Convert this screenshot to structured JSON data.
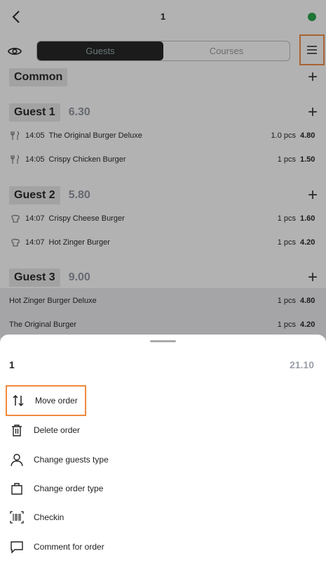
{
  "header": {
    "title": "1",
    "status_color": "#22a447"
  },
  "tabs": [
    {
      "label": "Guests",
      "active": true
    },
    {
      "label": "Courses",
      "active": false
    }
  ],
  "sections": {
    "common": {
      "label": "Common"
    },
    "guest1": {
      "label": "Guest 1",
      "total": "6.30",
      "items": [
        {
          "time": "14:05",
          "name": "The Original Burger Deluxe",
          "qty": "1.0 pcs",
          "price": "4.80",
          "icon": "fork-knife-icon"
        },
        {
          "time": "14:05",
          "name": "Crispy Chicken Burger",
          "qty": "1 pcs",
          "price": "1.50",
          "icon": "fork-knife-icon"
        }
      ]
    },
    "guest2": {
      "label": "Guest 2",
      "total": "5.80",
      "items": [
        {
          "time": "14:07",
          "name": "Crispy Cheese Burger",
          "qty": "1 pcs",
          "price": "1.60",
          "icon": "chef-hat-icon"
        },
        {
          "time": "14:07",
          "name": "Hot Zinger Burger",
          "qty": "1 pcs",
          "price": "4.20",
          "icon": "chef-hat-icon"
        }
      ]
    },
    "guest3": {
      "label": "Guest 3",
      "total": "9.00",
      "items": [
        {
          "name": "Hot Zinger Burger Deluxe",
          "qty": "1 pcs",
          "price": "4.80"
        },
        {
          "name": "The Original Burger",
          "qty": "1 pcs",
          "price": "4.20"
        }
      ]
    }
  },
  "sheet": {
    "title": "1",
    "total": "21.10",
    "actions": [
      {
        "label": "Move order",
        "icon": "swap-vertical-icon"
      },
      {
        "label": "Delete order",
        "icon": "trash-icon"
      },
      {
        "label": "Change guests type",
        "icon": "person-icon"
      },
      {
        "label": "Change order type",
        "icon": "bag-icon"
      },
      {
        "label": "Checkin",
        "icon": "barcode-scan-icon"
      },
      {
        "label": "Comment for order",
        "icon": "comment-icon"
      }
    ]
  },
  "accent_color": "#f08a3c"
}
